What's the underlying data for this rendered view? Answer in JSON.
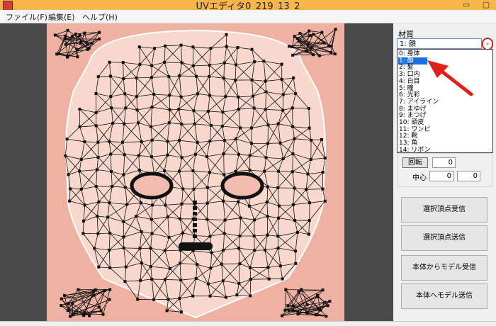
{
  "window": {
    "title": "UVエディタ0_219_13_2"
  },
  "menu": [
    {
      "label": "ファイル(F)"
    },
    {
      "label": "編集(E)"
    },
    {
      "label": "ヘルプ(H)"
    }
  ],
  "material": {
    "label": "材質",
    "selected": "1: 顔",
    "options": [
      "0: 身体",
      "1: 顔",
      "2: 髪",
      "3: 口内",
      "4: 白目",
      "5: 瞳",
      "6: 光彩",
      "7: アイライン",
      "8: まゆげ",
      "9: まつげ",
      "10: 頭皮",
      "11: ワンピ",
      "12: 靴",
      "13: 角",
      "14: リボン"
    ],
    "selected_index": 1
  },
  "transform": {
    "rotate_label": "回転",
    "rotate_value": "0",
    "center_label": "中心",
    "center_x": "0",
    "center_y": "0"
  },
  "buttons": {
    "receive_selected": "選択頂点受信",
    "send_selected": "選択頂点送信",
    "receive_model": "本体からモデル受信",
    "send_model": "本体へモデル送信"
  },
  "colors": {
    "uv_background": "#efb2a2",
    "face_fill": "#f8d7cc",
    "highlight": "#1f6ee0",
    "annotation": "#e0201a"
  }
}
